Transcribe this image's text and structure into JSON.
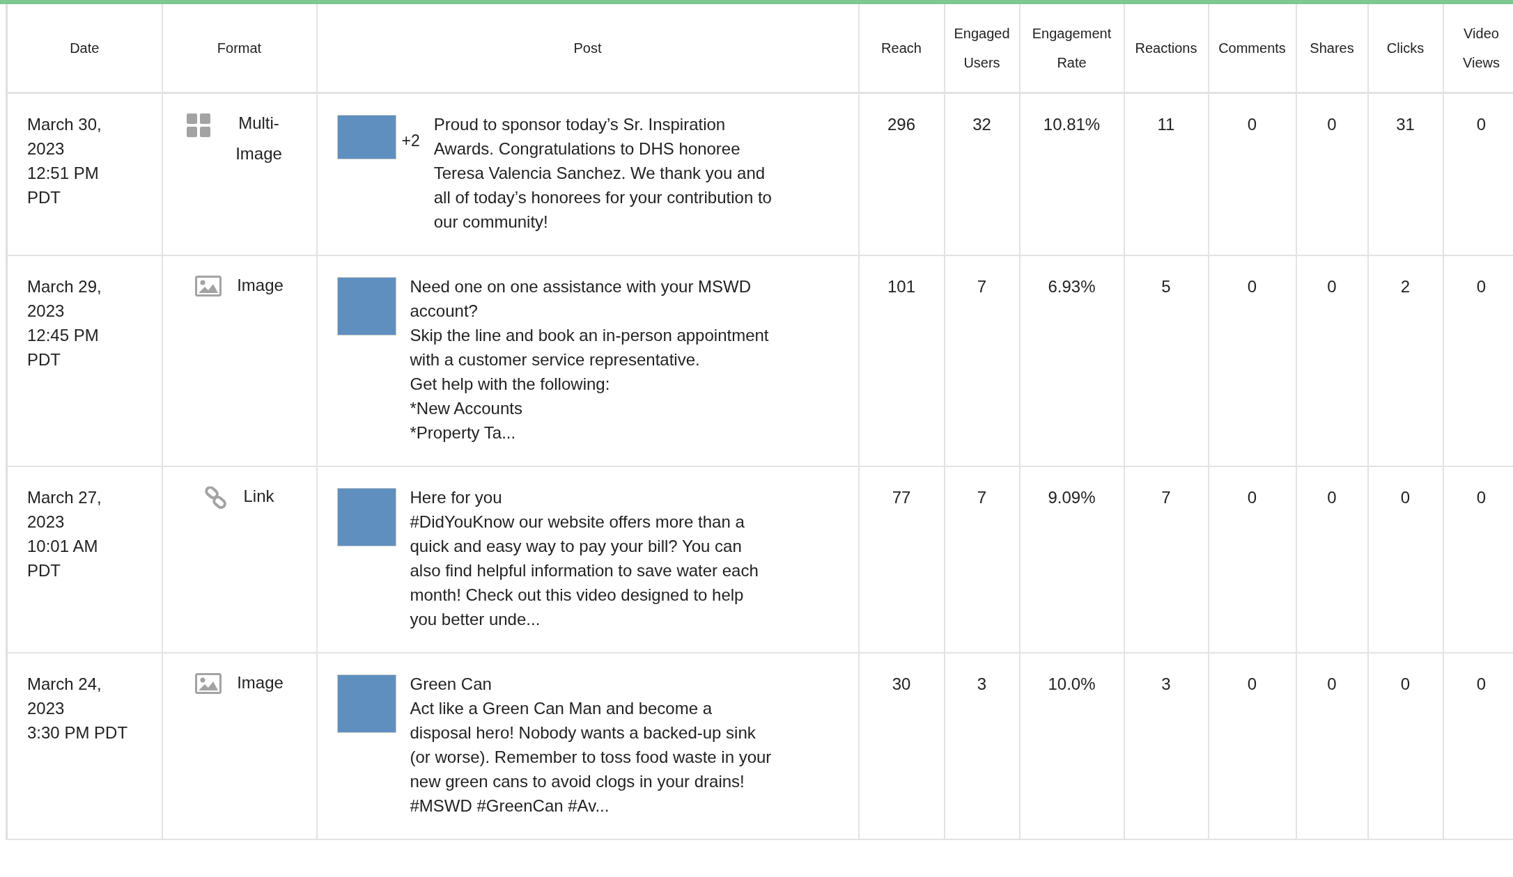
{
  "table": {
    "columns": [
      "Date",
      "Format",
      "Post",
      "Reach",
      "Engaged Users",
      "Engagement Rate",
      "Reactions",
      "Comments",
      "Shares",
      "Clicks",
      "Video Views"
    ],
    "rows": [
      {
        "date": "March 30, 2023",
        "time": "12:51 PM PDT",
        "format": {
          "kind": "multi-image",
          "label": "Multi-Image"
        },
        "extra_count": "+2",
        "post": "Proud to sponsor today’s Sr. Inspiration Awards. Congratulations to DHS honoree Teresa Valencia Sanchez. We thank you and all of today’s honorees for your contribution to our community!",
        "stats": [
          "296",
          "32",
          "10.81%",
          "11",
          "0",
          "0",
          "31",
          "0"
        ]
      },
      {
        "date": "March 29, 2023",
        "time": "12:45 PM PDT",
        "format": {
          "kind": "image",
          "label": "Image"
        },
        "post": "Need one on one assistance with your MSWD account?\nSkip the line and book an in-person appointment with a customer service representative.\nGet help with the following:\n*New Accounts\n*Property Ta...",
        "stats": [
          "101",
          "7",
          "6.93%",
          "5",
          "0",
          "0",
          "2",
          "0"
        ]
      },
      {
        "date": "March 27, 2023",
        "time": "10:01 AM PDT",
        "format": {
          "kind": "link",
          "label": "Link"
        },
        "post": "Here for you\n#DidYouKnow our website offers more than a quick and easy way to pay your bill? You can also find helpful information to save water each month! Check out this video designed to help you better unde...",
        "stats": [
          "77",
          "7",
          "9.09%",
          "7",
          "0",
          "0",
          "0",
          "0"
        ]
      },
      {
        "date": "March 24, 2023",
        "time": "3:30 PM PDT",
        "format": {
          "kind": "image",
          "label": "Image"
        },
        "post": "Green Can\nAct like a Green Can Man and become a disposal hero! Nobody wants a backed-up sink (or worse). Remember to toss food waste in your new green cans to avoid clogs in your drains!\n#MSWD #GreenCan #Av...",
        "stats": [
          "30",
          "3",
          "10.0%",
          "3",
          "0",
          "0",
          "0",
          "0"
        ]
      }
    ]
  }
}
